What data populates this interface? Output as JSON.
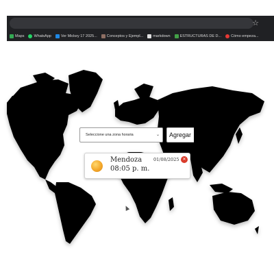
{
  "browser": {
    "bookmarks": [
      {
        "label": "Maps",
        "icon": "maps-icon",
        "color": "#34a853"
      },
      {
        "label": "WhatsApp",
        "icon": "whatsapp-icon",
        "color": "#25d366"
      },
      {
        "label": "Ver Mickey 17 2025...",
        "icon": "video-icon",
        "color": "#1e88e5"
      },
      {
        "label": "Conceptos y Ejempl...",
        "icon": "document-icon",
        "color": "#8d6e63"
      },
      {
        "label": "markdown",
        "icon": "markdown-icon",
        "color": "#e0e0e0"
      },
      {
        "label": "ESTRUCTURAS DE D...",
        "icon": "table-icon",
        "color": "#43a047"
      },
      {
        "label": "Cómo empeza...",
        "icon": "web-icon",
        "color": "#e53935"
      }
    ],
    "star_icon": "star-icon"
  },
  "controls": {
    "select_value": "Seleccione una zona horaria",
    "add_label": "Agregar"
  },
  "clocks": [
    {
      "city": "Mendoza",
      "time": "08:05 p. m.",
      "date": "01/08/2025",
      "icon": "sun-icon",
      "delete_icon": "delete-icon"
    }
  ],
  "colors": {
    "chrome": "#202124",
    "map_land": "#000000",
    "delete": "#d93b2b",
    "sun": "#f4a82a"
  }
}
